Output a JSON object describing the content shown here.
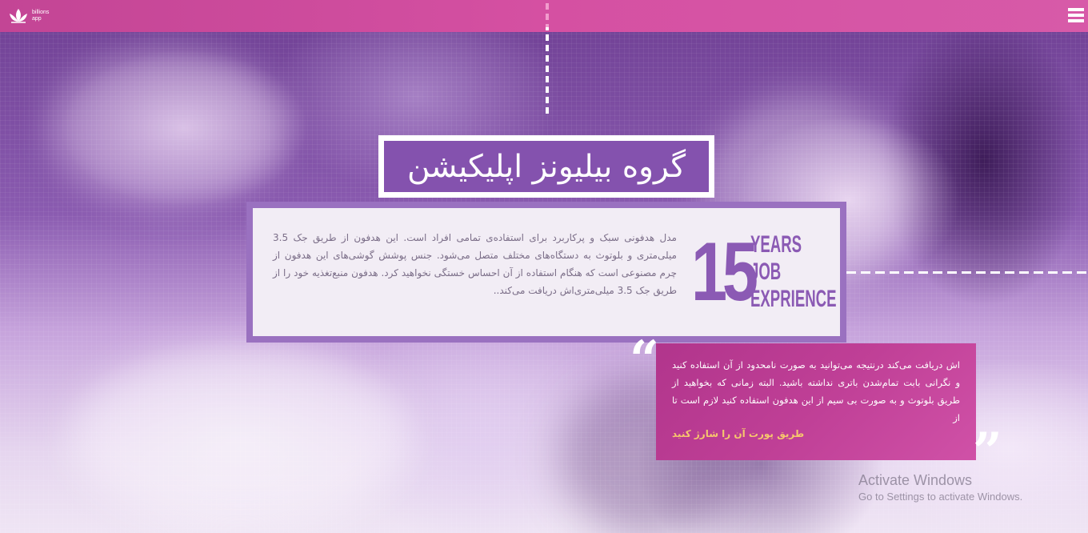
{
  "header": {
    "logo_text": "billions app",
    "menu_icon": "hamburger-menu-icon",
    "bar_color": "#d04c9f"
  },
  "hero": {
    "title": "گروه بیلیونز اپلیکیشن"
  },
  "info": {
    "description": "مدل هدفونی سبک و پرکاربرد برای استفاده‌ی تمامی افراد است. این هدفون از طریق جک 3.5 میلی‌متری و بلوتوث به دستگاه‌های مختلف متصل می‌شود. جنس پوشش گوشی‌های این هدفون از چرم مصنوعی است که هنگام استفاده از آن احساس خستگی نخواهید کرد. هدفون منبع‌تغذیه خود را از طریق جک 3.5 میلی‌متری‌اش دریافت می‌کند..",
    "years_number": "15",
    "years_line1": "YEARS",
    "years_line2": "JOB",
    "years_line3": "EXPRIENCE",
    "accent_color": "#8b5ab4"
  },
  "quote": {
    "text": "اش دریافت می‌کند درنتیجه می‌توانید به صورت نامحدود از آن استفاده کنید و نگرانی بابت تمام‌شدن باتری نداشته باشید. البته زمانی که بخواهید از طریق بلوتوث و به صورت بی سیم از این هدفون استفاده کنید لازم است تا از",
    "link_text": "طریق پورت آن را شارژ کنید",
    "open_mark": "“",
    "close_mark": "”",
    "box_color": "#bf3f96",
    "link_color": "#f6c76d"
  },
  "watermark": {
    "title": "Activate Windows",
    "subtitle": "Go to Settings to activate Windows."
  }
}
